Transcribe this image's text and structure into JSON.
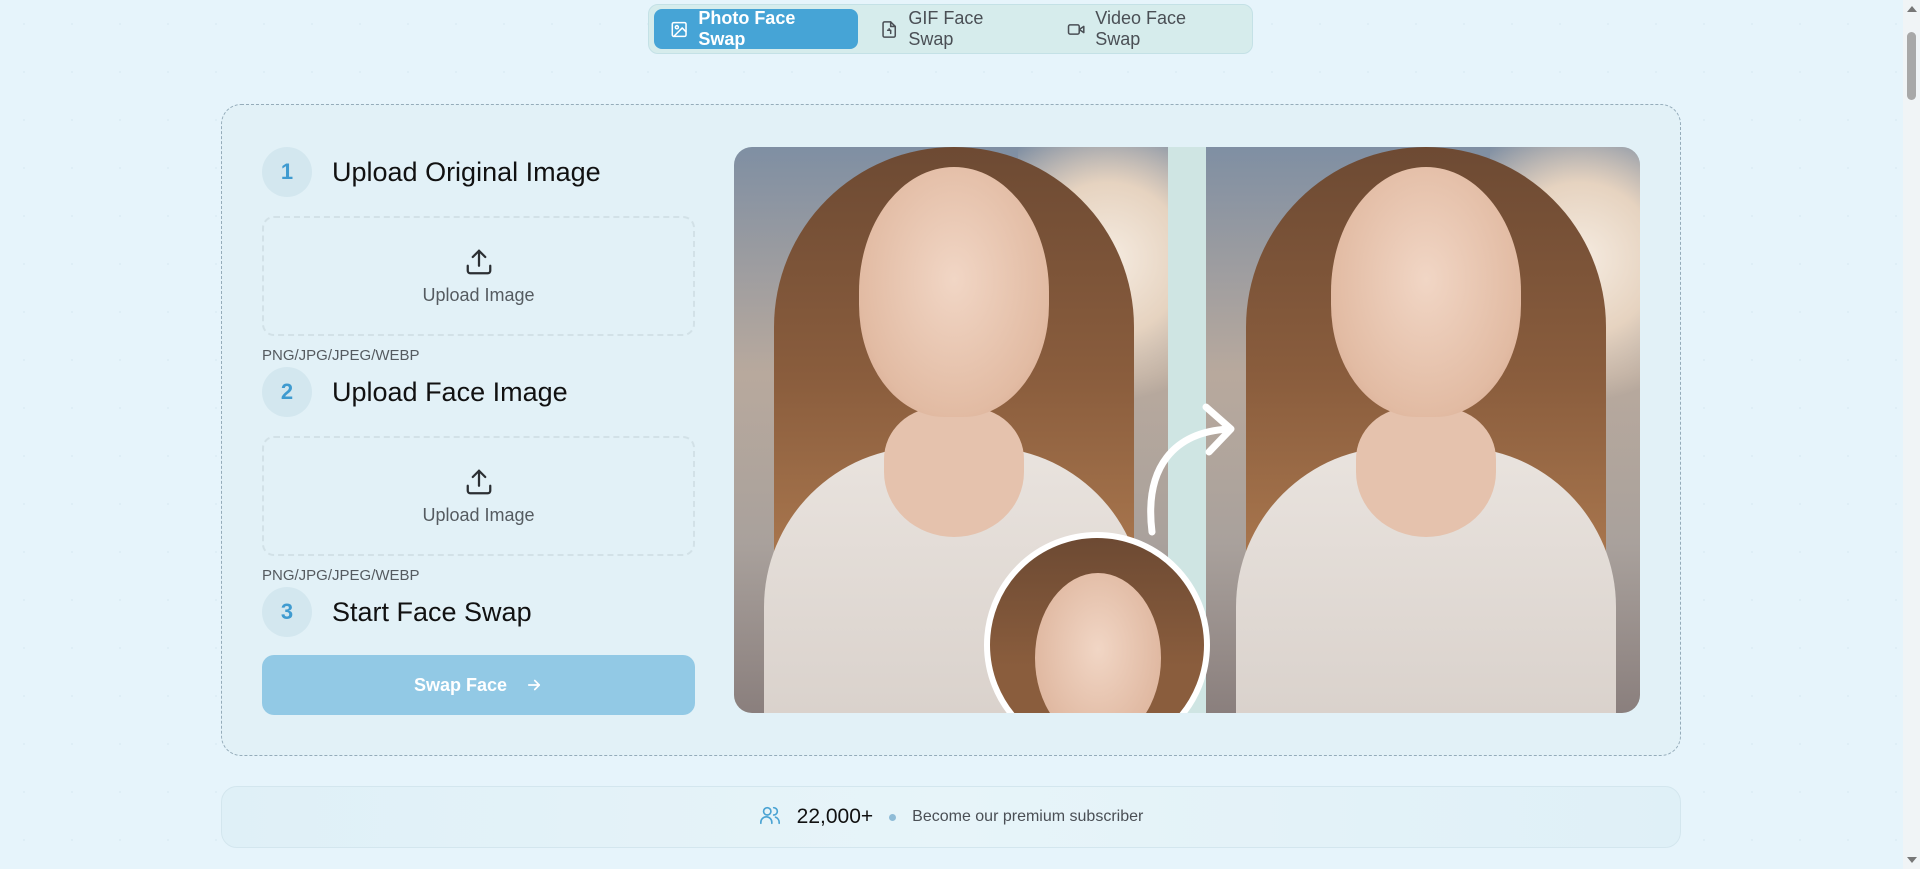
{
  "tabs": [
    {
      "label": "Photo Face Swap",
      "icon": "image-icon",
      "active": true
    },
    {
      "label": "GIF Face Swap",
      "icon": "file-gif-icon",
      "active": false
    },
    {
      "label": "Video Face Swap",
      "icon": "video-icon",
      "active": false
    }
  ],
  "steps": [
    {
      "number": "1",
      "title": "Upload Original Image",
      "upload_label": "Upload Image",
      "formats": "PNG/JPG/JPEG/WEBP"
    },
    {
      "number": "2",
      "title": "Upload Face Image",
      "upload_label": "Upload Image",
      "formats": "PNG/JPG/JPEG/WEBP"
    },
    {
      "number": "3",
      "title": "Start Face Swap"
    }
  ],
  "swap_button": {
    "label": "Swap Face"
  },
  "subscriber_bar": {
    "count": "22,000+",
    "text": "Become our premium subscriber"
  },
  "colors": {
    "accent": "#46a4d6",
    "button_disabled": "#92c9e5",
    "step_number": "#3f9bd0",
    "background": "#e6f4fb"
  }
}
